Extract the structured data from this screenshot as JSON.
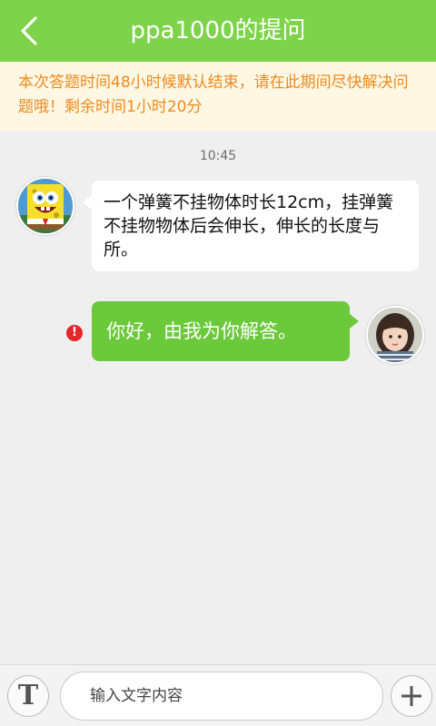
{
  "header": {
    "title": "ppa1000的提问",
    "back_icon": "chevron-left-icon",
    "background": "#7dd34a"
  },
  "notice": {
    "text": "本次答题时间48小时候默认结束，请在此期间尽快解决问题哦！剩余时间1小时20分",
    "color": "#f08b1e"
  },
  "chat": {
    "time": "10:45",
    "messages": [
      {
        "side": "left",
        "avatar": "spongebob-avatar",
        "text": "一个弹簧不挂物体时长12cm，挂弹簧不挂物物体后会伸长，伸长的长度与所。"
      },
      {
        "side": "right",
        "avatar": "girl-avatar",
        "text": "你好，由我为你解答。",
        "status": "failed",
        "status_symbol": "!"
      }
    ]
  },
  "composer": {
    "text_mode_icon": "text-format-icon",
    "text_mode_label": "T",
    "placeholder": "输入文字内容",
    "value": "",
    "add_icon": "plus-icon"
  }
}
